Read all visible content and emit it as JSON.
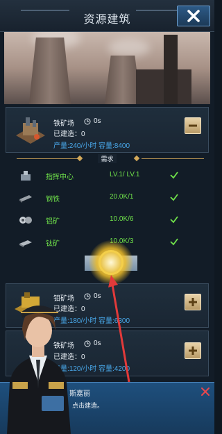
{
  "header": {
    "title": "资源建筑"
  },
  "buildings": [
    {
      "name": "铁矿场",
      "time": "0s",
      "built": "已建造：0",
      "production": "产量:240/小时  容量:8400",
      "action": "minus"
    },
    {
      "name": "钼矿场",
      "time": "0s",
      "built": "已建造：0",
      "production": "产量:180/小时  容量:6300",
      "action": "plus"
    },
    {
      "name": "铁矿场",
      "time": "0s",
      "built": "已建造：0",
      "production": "产量:120/小时  容量:4200",
      "action": "plus"
    }
  ],
  "requirements": {
    "title": "需求",
    "items": [
      {
        "icon": "command-center-icon",
        "name": "指挥中心",
        "value": "LV.1/ LV.1"
      },
      {
        "icon": "steel-icon",
        "name": "钢铁",
        "value": "20.0K/1"
      },
      {
        "icon": "aluminum-icon",
        "name": "铝矿",
        "value": "10.0K/6"
      },
      {
        "icon": "titanium-icon",
        "name": "钛矿",
        "value": "10.0K/3"
      }
    ]
  },
  "dialog": {
    "speaker": "斯嘉丽",
    "text": "点击建造。"
  },
  "colors": {
    "accent_green": "#6fe14a",
    "accent_blue": "#49a8ea",
    "close_red": "#e8474d"
  }
}
